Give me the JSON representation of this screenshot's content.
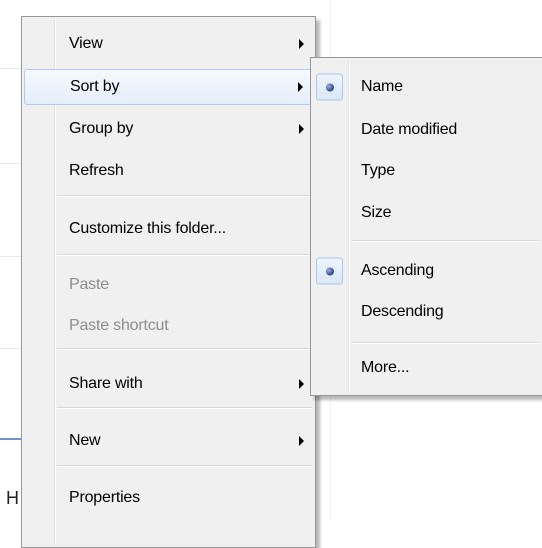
{
  "context_menu": {
    "items": [
      {
        "label": "View",
        "submenu": true,
        "state": "normal"
      },
      {
        "label": "Sort by",
        "submenu": true,
        "state": "highlighted"
      },
      {
        "label": "Group by",
        "submenu": true,
        "state": "normal"
      },
      {
        "label": "Refresh",
        "submenu": false,
        "state": "normal"
      },
      {
        "label": "Customize this folder...",
        "submenu": false,
        "state": "normal"
      },
      {
        "label": "Paste",
        "submenu": false,
        "state": "disabled"
      },
      {
        "label": "Paste shortcut",
        "submenu": false,
        "state": "disabled"
      },
      {
        "label": "Share with",
        "submenu": true,
        "state": "normal"
      },
      {
        "label": "New",
        "submenu": true,
        "state": "normal"
      },
      {
        "label": "Properties",
        "submenu": false,
        "state": "normal"
      }
    ]
  },
  "sort_submenu": {
    "items": [
      {
        "label": "Name",
        "selected": true
      },
      {
        "label": "Date modified",
        "selected": false
      },
      {
        "label": "Type",
        "selected": false
      },
      {
        "label": "Size",
        "selected": false
      },
      {
        "label": "Ascending",
        "selected": true
      },
      {
        "label": "Descending",
        "selected": false
      },
      {
        "label": "More...",
        "selected": false
      }
    ]
  },
  "background": {
    "partial_text": "H"
  },
  "colors": {
    "menu_background": "#f0f0f0",
    "menu_border": "#979797",
    "highlight_border": "#aeccf1",
    "disabled_text": "#8d8d8d",
    "radio_dot": "#2b3f86"
  }
}
